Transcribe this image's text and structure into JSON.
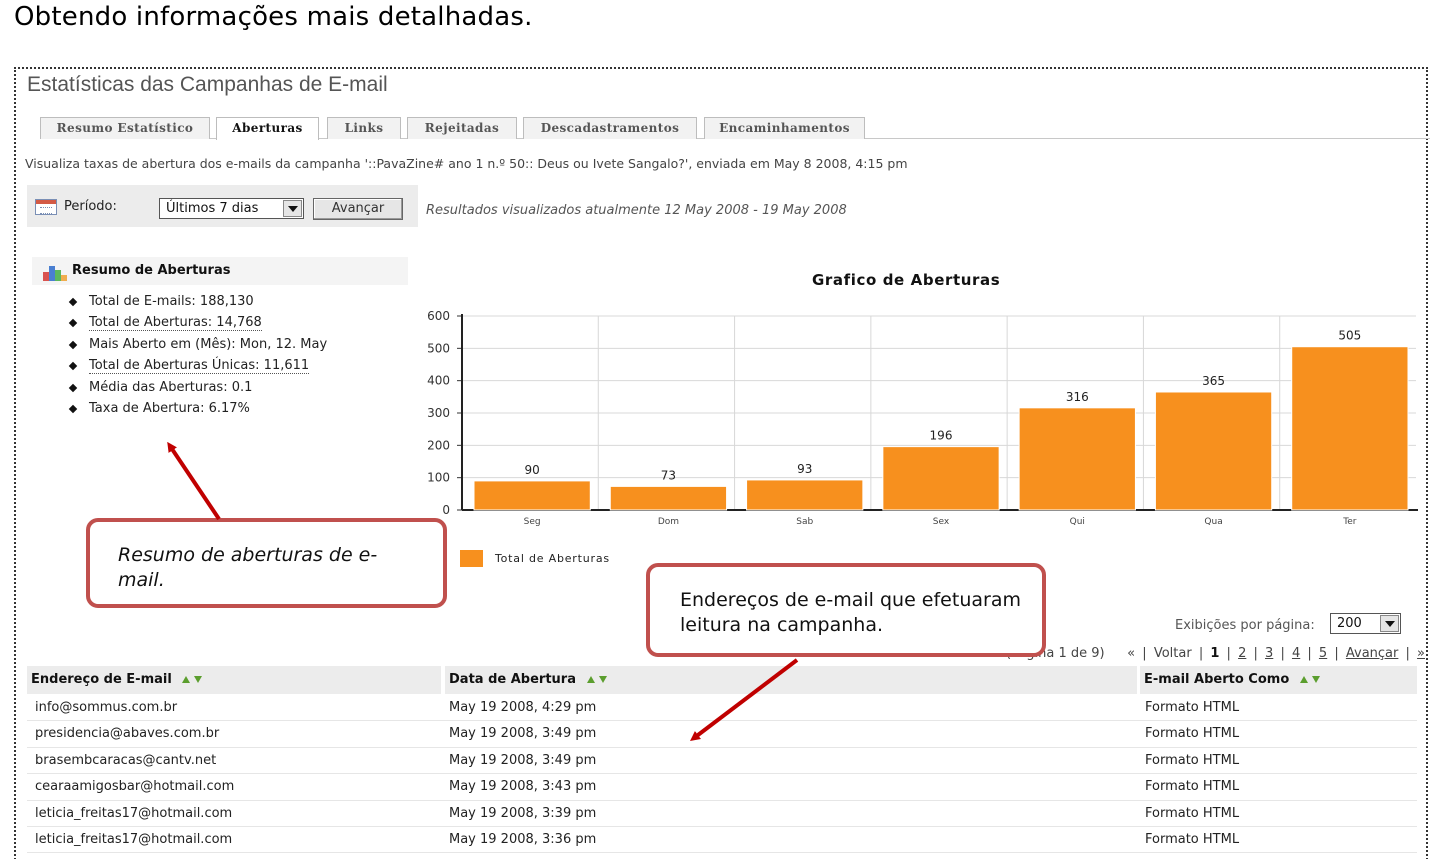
{
  "doc_heading": "Obtendo informações mais detalhadas.",
  "app_title": "Estatísticas das Campanhas de E-mail",
  "tabs": [
    {
      "label": "Resumo Estatístico",
      "active": false
    },
    {
      "label": "Aberturas",
      "active": true
    },
    {
      "label": "Links",
      "active": false
    },
    {
      "label": "Rejeitadas",
      "active": false
    },
    {
      "label": "Descadastramentos",
      "active": false
    },
    {
      "label": "Encaminhamentos",
      "active": false
    }
  ],
  "description": "Visualiza taxas de abertura dos e-mails da campanha '::PavaZine# ano 1 n.º 50:: Deus ou Ivete Sangalo?', enviada em May 8 2008, 4:15 pm",
  "period": {
    "label": "Período:",
    "selected": "Últimos 7 dias",
    "button_label": "Avançar",
    "results_range": "Resultados visualizados atualmente 12 May 2008 - 19 May 2008"
  },
  "summary": {
    "title": "Resumo de Aberturas",
    "items": [
      "Total de E-mails: 188,130",
      "Total de Aberturas: 14,768",
      "Mais Aberto em (Mês): Mon, 12. May",
      "Total de Aberturas Únicas: 11,611",
      "Média das Aberturas: 0.1",
      "Taxa de Abertura: 6.17%"
    ]
  },
  "chart_data": {
    "type": "bar",
    "title": "Grafico de Aberturas",
    "categories": [
      "Seg",
      "Dom",
      "Sab",
      "Sex",
      "Qui",
      "Qua",
      "Ter"
    ],
    "series": [
      {
        "name": "Total de Aberturas",
        "values": [
          90,
          73,
          93,
          196,
          316,
          365,
          505
        ]
      }
    ],
    "ylim": [
      0,
      600
    ],
    "yticks": [
      0,
      100,
      200,
      300,
      400,
      500,
      600
    ],
    "grid": true,
    "legend": "bottom-left",
    "bar_color": "#f7901e"
  },
  "callouts": {
    "summary_note": "Resumo de aberturas de e-mail.",
    "table_note": "Endereços de e-mail que efetuaram leitura na campanha."
  },
  "per_page": {
    "label": "Exibições por página:",
    "selected": "200"
  },
  "pagination": {
    "info": "(Página 1 de 9)",
    "first": "«",
    "back": "Voltar",
    "pages": [
      "1",
      "2",
      "3",
      "4",
      "5"
    ],
    "current": "1",
    "next": "Avançar",
    "last": "»"
  },
  "table": {
    "columns": [
      "Endereço de E-mail",
      "Data de Abertura",
      "E-mail Aberto Como"
    ],
    "rows": [
      [
        "info@sommus.com.br",
        "May 19 2008, 4:29 pm",
        "Formato HTML"
      ],
      [
        "presidencia@abaves.com.br",
        "May 19 2008, 3:49 pm",
        "Formato HTML"
      ],
      [
        "brasembcaracas@cantv.net",
        "May 19 2008, 3:49 pm",
        "Formato HTML"
      ],
      [
        "cearaamigosbar@hotmail.com",
        "May 19 2008, 3:43 pm",
        "Formato HTML"
      ],
      [
        "leticia_freitas17@hotmail.com",
        "May 19 2008, 3:39 pm",
        "Formato HTML"
      ],
      [
        "leticia_freitas17@hotmail.com",
        "May 19 2008, 3:36 pm",
        "Formato HTML"
      ]
    ]
  },
  "colors": {
    "accent_orange": "#f7901e",
    "callout_border": "#c0504d",
    "arrow_red": "#c00000",
    "sort_arrow_green": "#5b9e2e"
  }
}
